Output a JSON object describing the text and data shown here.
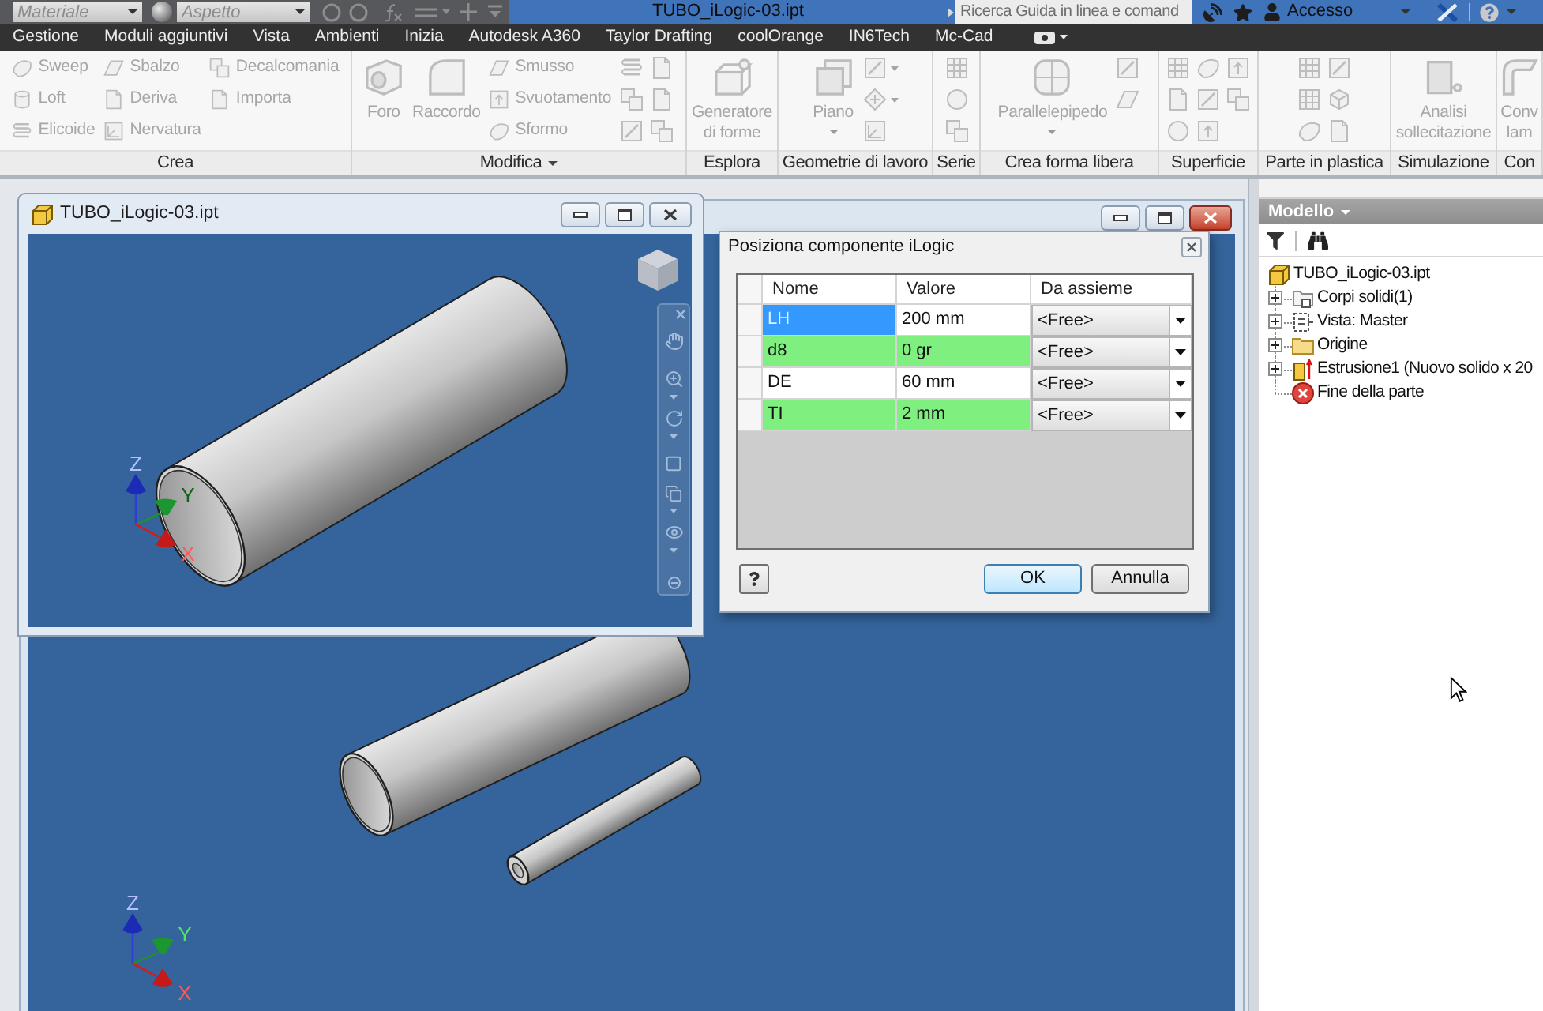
{
  "quick_access": {
    "material": {
      "placeholder": "Materiale"
    },
    "appearance": {
      "placeholder": "Aspetto"
    }
  },
  "title_bar": {
    "title": "TUBO_iLogic-03.ipt",
    "search": {
      "placeholder": "Ricerca Guida in linea e comand"
    },
    "account": "Accesso"
  },
  "menu_tabs": [
    {
      "label": "Gestione",
      "selected": false
    },
    {
      "label": "Moduli aggiuntivi",
      "selected": false
    },
    {
      "label": "Vista",
      "selected": false
    },
    {
      "label": "Ambienti",
      "selected": false
    },
    {
      "label": "Inizia",
      "selected": false
    },
    {
      "label": "Autodesk A360",
      "selected": false
    },
    {
      "label": "Taylor Drafting",
      "selected": false
    },
    {
      "label": "coolOrange",
      "selected": false
    },
    {
      "label": "IN6Tech",
      "selected": false
    },
    {
      "label": "Mc-Cad",
      "selected": false
    }
  ],
  "ribbon": {
    "panels": [
      {
        "label": "Crea",
        "tools": [
          {
            "label": "Sweep",
            "kind": "small",
            "disabled": true
          },
          {
            "label": "Loft",
            "kind": "small",
            "disabled": true
          },
          {
            "label": "Elicoide",
            "kind": "small",
            "disabled": true
          },
          {
            "label": "Sbalzo",
            "kind": "small",
            "disabled": true
          },
          {
            "label": "Deriva",
            "kind": "small",
            "disabled": true
          },
          {
            "label": "Nervatura",
            "kind": "small",
            "disabled": true
          },
          {
            "label": "Decalcomania",
            "kind": "small",
            "disabled": true
          },
          {
            "label": "Importa",
            "kind": "small",
            "disabled": true
          }
        ]
      },
      {
        "label": "Modifica",
        "menu": true,
        "tools": [
          {
            "label": "Foro",
            "kind": "large",
            "disabled": true
          },
          {
            "label": "Raccordo",
            "kind": "large",
            "disabled": true
          },
          {
            "label": "Smusso",
            "kind": "small",
            "disabled": true
          },
          {
            "label": "Svuotamento",
            "kind": "small",
            "disabled": true
          },
          {
            "label": "Sformo",
            "kind": "small",
            "disabled": true
          }
        ]
      },
      {
        "label": "Esplora",
        "tools": [
          {
            "label": "Generatore di forme",
            "kind": "large",
            "disabled": true
          }
        ]
      },
      {
        "label": "Geometrie di lavoro",
        "tools": [
          {
            "label": "Piano",
            "kind": "large",
            "disabled": true,
            "dropdown": true
          }
        ]
      },
      {
        "label": "Serie"
      },
      {
        "label": "Crea forma libera",
        "tools": [
          {
            "label": "Parallelepipedo",
            "kind": "large",
            "disabled": true,
            "dropdown": true
          }
        ]
      },
      {
        "label": "Superficie"
      },
      {
        "label": "Parte in plastica"
      },
      {
        "label": "Simulazione",
        "tools": [
          {
            "label": "Analisi sollecitazione",
            "kind": "large",
            "disabled": true
          }
        ]
      },
      {
        "label": "Con",
        "tools": [
          {
            "label": "Conv lam",
            "kind": "large",
            "disabled": true
          }
        ]
      }
    ]
  },
  "main_window": {
    "active": true,
    "triad": {
      "z": "Z",
      "y": "Y",
      "x": "X"
    }
  },
  "part_window": {
    "title": "TUBO_iLogic-03.ipt",
    "active": false,
    "triad": {
      "z": "Z",
      "y": "Y",
      "x": "X"
    }
  },
  "dialog": {
    "title": "Posiziona componente iLogic",
    "columns": [
      "Nome",
      "Valore",
      "Da assieme"
    ],
    "rows": [
      {
        "name": "LH",
        "value": "200 mm",
        "source": "<Free>",
        "color": "#ffffff",
        "selected": true
      },
      {
        "name": "d8",
        "value": "0 gr",
        "source": "<Free>",
        "color": "#7ff07f",
        "selected": false
      },
      {
        "name": "DE",
        "value": "60 mm",
        "source": "<Free>",
        "color": "#ffffff",
        "selected": false
      },
      {
        "name": "TI",
        "value": "2 mm",
        "source": "<Free>",
        "color": "#7ff07f",
        "selected": false
      }
    ],
    "buttons": [
      {
        "label": "OK",
        "default": true
      },
      {
        "label": "Annulla",
        "default": false
      }
    ]
  },
  "browser": {
    "title": "Modello",
    "menu": true,
    "tree": [
      {
        "label": "TUBO_iLogic-03.ipt",
        "kind": "part",
        "children": [
          {
            "label": "Corpi solidi(1)",
            "kind": "bodies",
            "expanded": false
          },
          {
            "label": "Vista: Master",
            "kind": "view",
            "expanded": false
          },
          {
            "label": "Origine",
            "kind": "folder",
            "expanded": false
          },
          {
            "label": "Estrusione1 (Nuovo solido x 20",
            "kind": "extrusion",
            "expanded": false
          },
          {
            "label": "Fine della parte",
            "kind": "end"
          }
        ]
      }
    ]
  }
}
